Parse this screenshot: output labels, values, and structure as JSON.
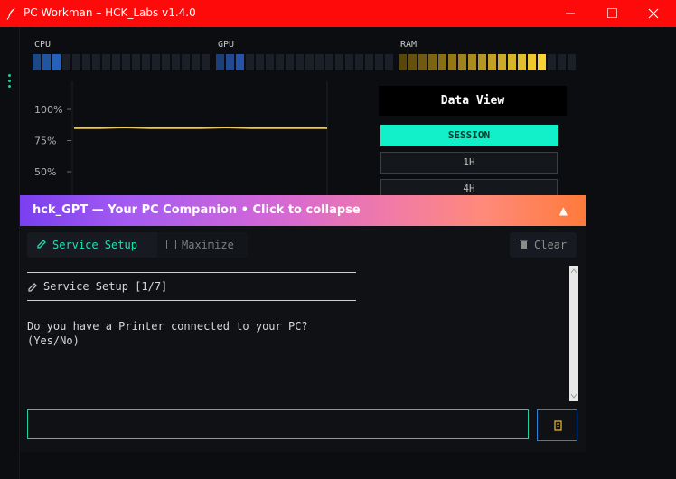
{
  "window": {
    "title": "PC Workman – HCK_Labs v1.4.0",
    "controls": [
      "minimize",
      "maximize",
      "close"
    ]
  },
  "meters": {
    "cpu": {
      "label": "CPU",
      "level": 0.18,
      "color": "#2a6fd6"
    },
    "gpu": {
      "label": "GPU",
      "level": 0.15,
      "color": "#2a5fc0"
    },
    "ram": {
      "label": "RAM",
      "level": 0.82,
      "color": "#e0b830"
    }
  },
  "chart": {
    "y_ticks": [
      "100%",
      "75%",
      "50%"
    ],
    "line_color": "#f2c84b"
  },
  "data_view": {
    "title": "Data View",
    "buttons": [
      {
        "label": "SESSION",
        "active": true
      },
      {
        "label": "1H",
        "active": false
      },
      {
        "label": "4H",
        "active": false
      }
    ]
  },
  "banner": {
    "text": "hck_GPT — Your PC Companion  •  Click to collapse",
    "arrow": "▲"
  },
  "chat": {
    "toolbar": {
      "service_setup": "Service Setup",
      "maximize": "Maximize",
      "clear": "Clear"
    },
    "messages": {
      "header": "Service Setup [1/7]",
      "question_line1": "Do you have a Printer connected to your PC?",
      "question_line2": "(Yes/No)"
    },
    "input": {
      "value": "",
      "placeholder": ""
    }
  },
  "colors": {
    "titlebar": "#ff0a0a",
    "accent_teal": "#11f0c8",
    "banner_start": "#7a3ff0",
    "banner_end": "#ff7a3a"
  },
  "chart_data": {
    "type": "line",
    "y_ticks": [
      "100%",
      "75%",
      "50%"
    ],
    "ylim": [
      25,
      100
    ],
    "series": [
      {
        "values": [
          85,
          85,
          85.5,
          85,
          85,
          85,
          85.5,
          85,
          85,
          85,
          85
        ]
      }
    ]
  }
}
